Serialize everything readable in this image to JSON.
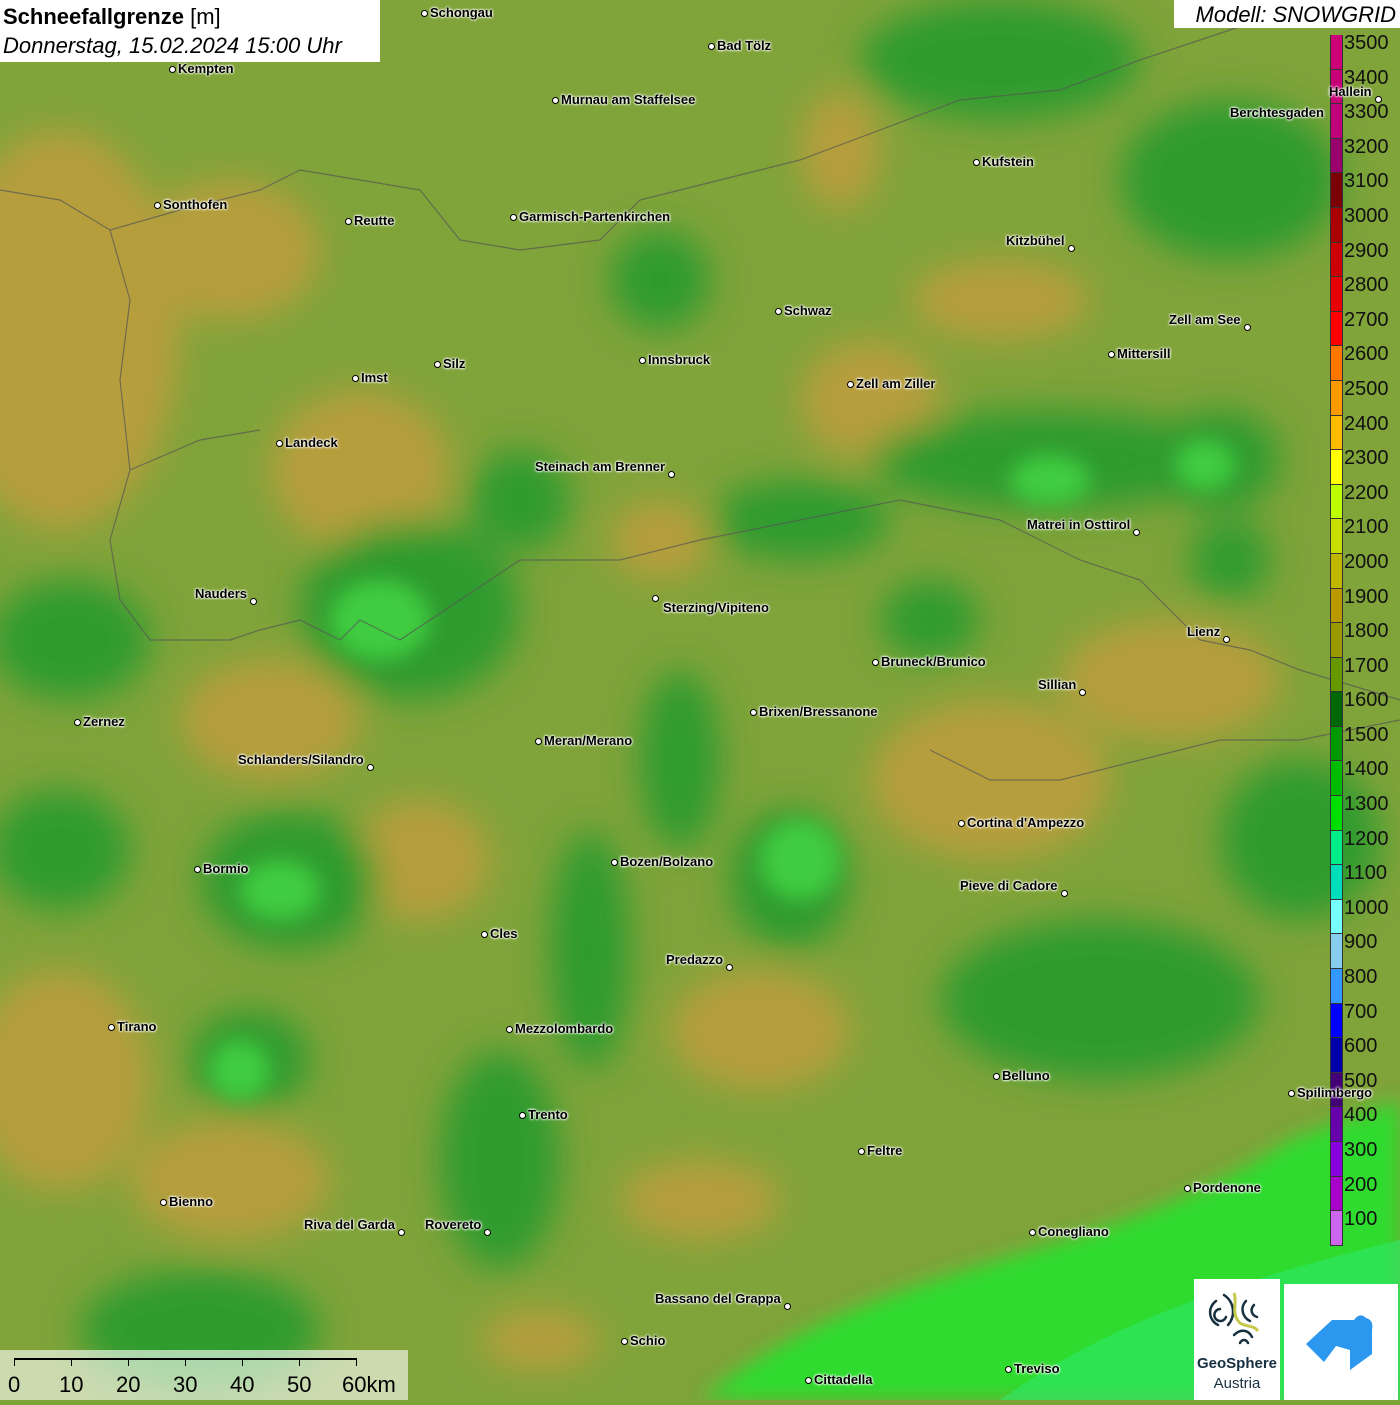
{
  "header": {
    "title": "Schneefallgrenze",
    "unit": "[m]",
    "datetime": "Donnerstag, 15.02.2024 15:00 Uhr"
  },
  "model": {
    "label": "Modell: SNOWGRID"
  },
  "legend": {
    "labels": [
      "3500",
      "3400",
      "3300",
      "3200",
      "3100",
      "3000",
      "2900",
      "2800",
      "2700",
      "2600",
      "2500",
      "2400",
      "2300",
      "2200",
      "2100",
      "2000",
      "1900",
      "1800",
      "1700",
      "1600",
      "1500",
      "1400",
      "1300",
      "1200",
      "1100",
      "1000",
      "900",
      "800",
      "700",
      "600",
      "500",
      "400",
      "300",
      "200",
      "100"
    ],
    "colors": [
      "#cc0077",
      "#c80078",
      "#c0007a",
      "#99006e",
      "#7a0000",
      "#aa0000",
      "#cc0000",
      "#e60000",
      "#ff0000",
      "#ff7700",
      "#ff9900",
      "#ffbb00",
      "#ffff00",
      "#bbff00",
      "#c8dd00",
      "#c0b800",
      "#bb9900",
      "#999900",
      "#669900",
      "#006600",
      "#009900",
      "#00bb00",
      "#00dd00",
      "#00ee88",
      "#00ddbb",
      "#77ffff",
      "#88ccee",
      "#3399ff",
      "#0000ff",
      "#0000aa",
      "#440077",
      "#6600aa",
      "#8800dd",
      "#aa00cc",
      "#cc66ee"
    ]
  },
  "cities": [
    "Schongau",
    "Bad Tölz",
    "Kempten",
    "Murnau am Staffelsee",
    "Hallein",
    "Berchtesgaden",
    "Kufstein",
    "Sonthofen",
    "Reutte",
    "Garmisch-Partenkirchen",
    "Kitzbühel",
    "Schwaz",
    "Zell am See",
    "Mittersill",
    "Innsbruck",
    "Silz",
    "Imst",
    "Zell am Ziller",
    "Landeck",
    "Steinach am Brenner",
    "Matrei in Osttirol",
    "Nauders",
    "Sterzing/Vipiteno",
    "Lienz",
    "Bruneck/Brunico",
    "Sillian",
    "Brixen/Bressanone",
    "Zernez",
    "Meran/Merano",
    "Schlanders/Silandro",
    "Cortina d'Ampezzo",
    "Bozen/Bolzano",
    "Bormio",
    "Pieve di Cadore",
    "Cles",
    "Predazzo",
    "Tirano",
    "Mezzolombardo",
    "Belluno",
    "Spilimbergo",
    "Trento",
    "Feltre",
    "Pordenone",
    "Bienno",
    "Riva del Garda",
    "Rovereto",
    "Conegliano",
    "Bassano del Grappa",
    "Schio",
    "Treviso",
    "Cittadella"
  ],
  "scale": {
    "labels": [
      "0",
      "10",
      "20",
      "30",
      "40",
      "50",
      "60km"
    ]
  },
  "logos": {
    "geosphere_line1": "GeoSphere",
    "geosphere_line2": "Austria"
  }
}
